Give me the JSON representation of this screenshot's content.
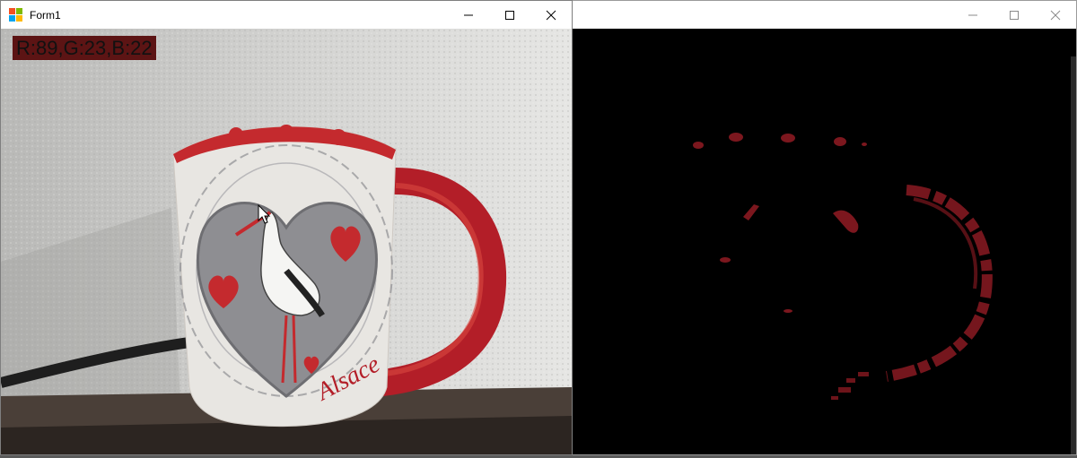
{
  "left_window": {
    "title": "Form1",
    "icon": "winforms-app-icon",
    "pixel_readout": "R:89,G:23,B:22",
    "controls": [
      "minimize-icon",
      "maximize-icon",
      "close-icon"
    ]
  },
  "right_window": {
    "title": "",
    "controls": [
      "minimize-icon",
      "maximize-icon",
      "close-icon"
    ]
  },
  "mug_text": "Alsace",
  "colors": {
    "readout_bg": "#5c1414",
    "mug_red": "#b31e28",
    "mask_red": "#8a1a22"
  }
}
